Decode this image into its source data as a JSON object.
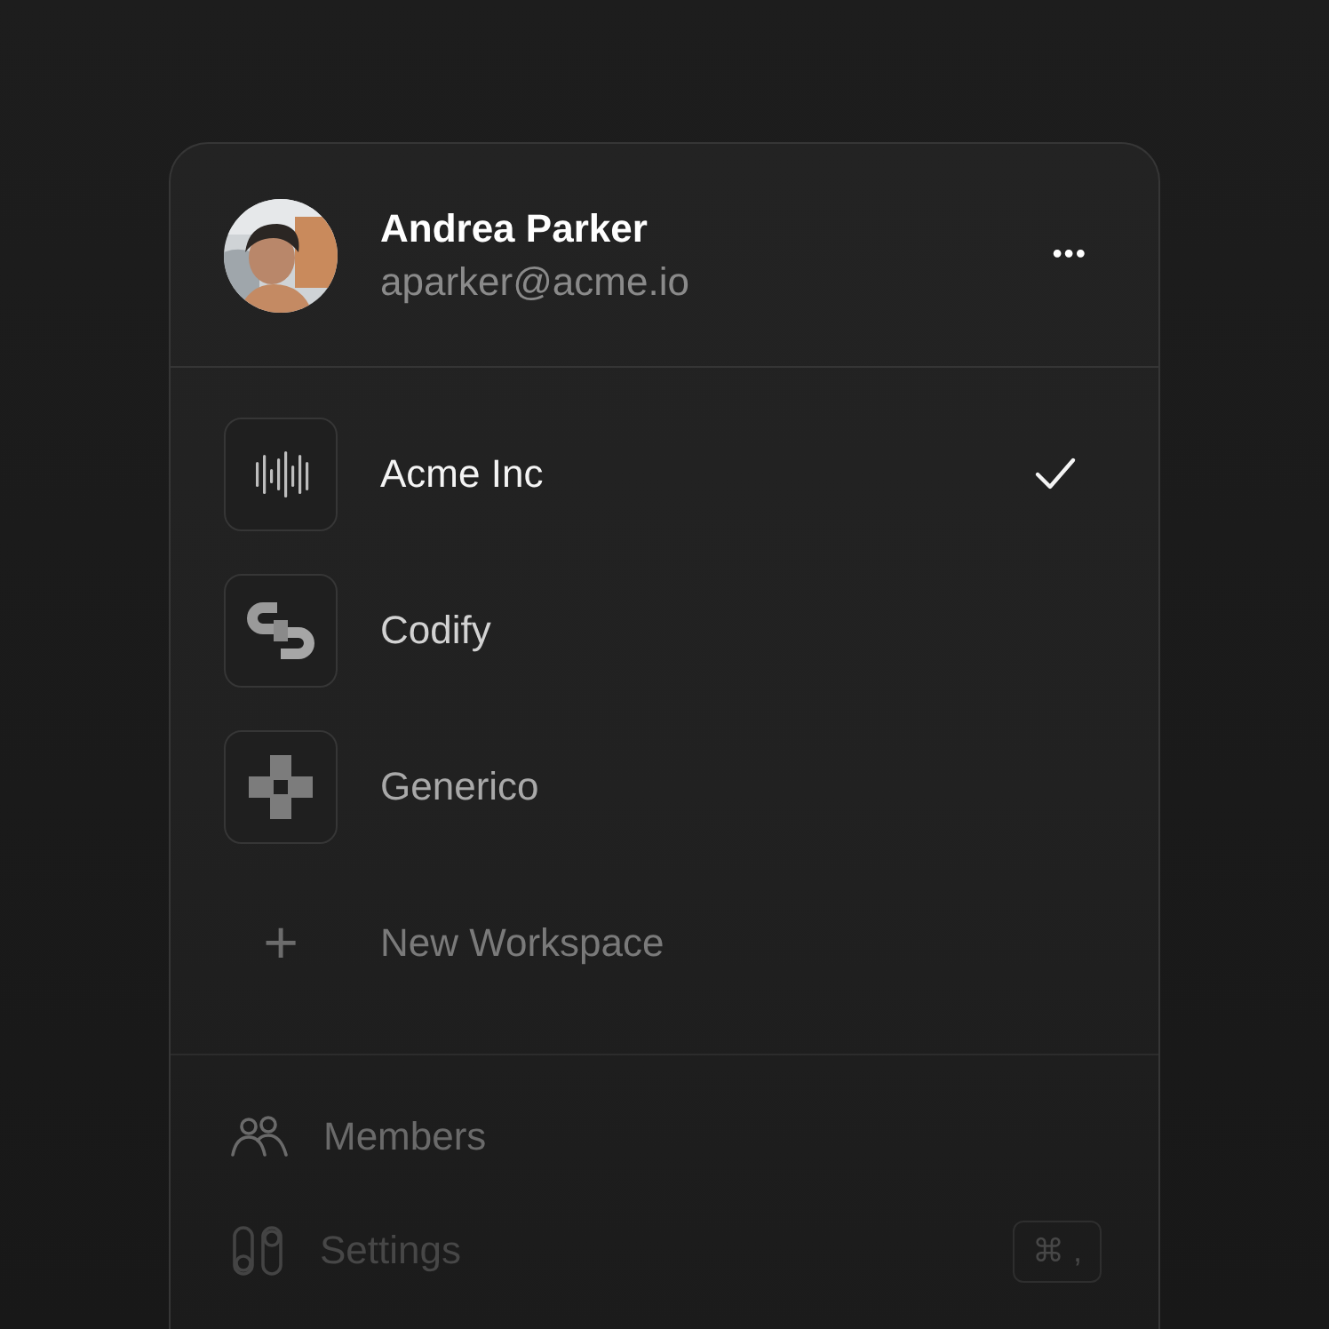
{
  "user": {
    "name": "Andrea Parker",
    "email": "aparker@acme.io",
    "menu_button": "•••"
  },
  "workspaces": [
    {
      "name": "Acme Inc",
      "selected": true
    },
    {
      "name": "Codify",
      "selected": false
    },
    {
      "name": "Generico",
      "selected": false
    }
  ],
  "new_workspace": {
    "icon": "+",
    "label": "New Workspace"
  },
  "menu": [
    {
      "kind": "members",
      "label": "Members"
    },
    {
      "kind": "settings",
      "label": "Settings",
      "shortcut": "⌘ ,"
    }
  ]
}
